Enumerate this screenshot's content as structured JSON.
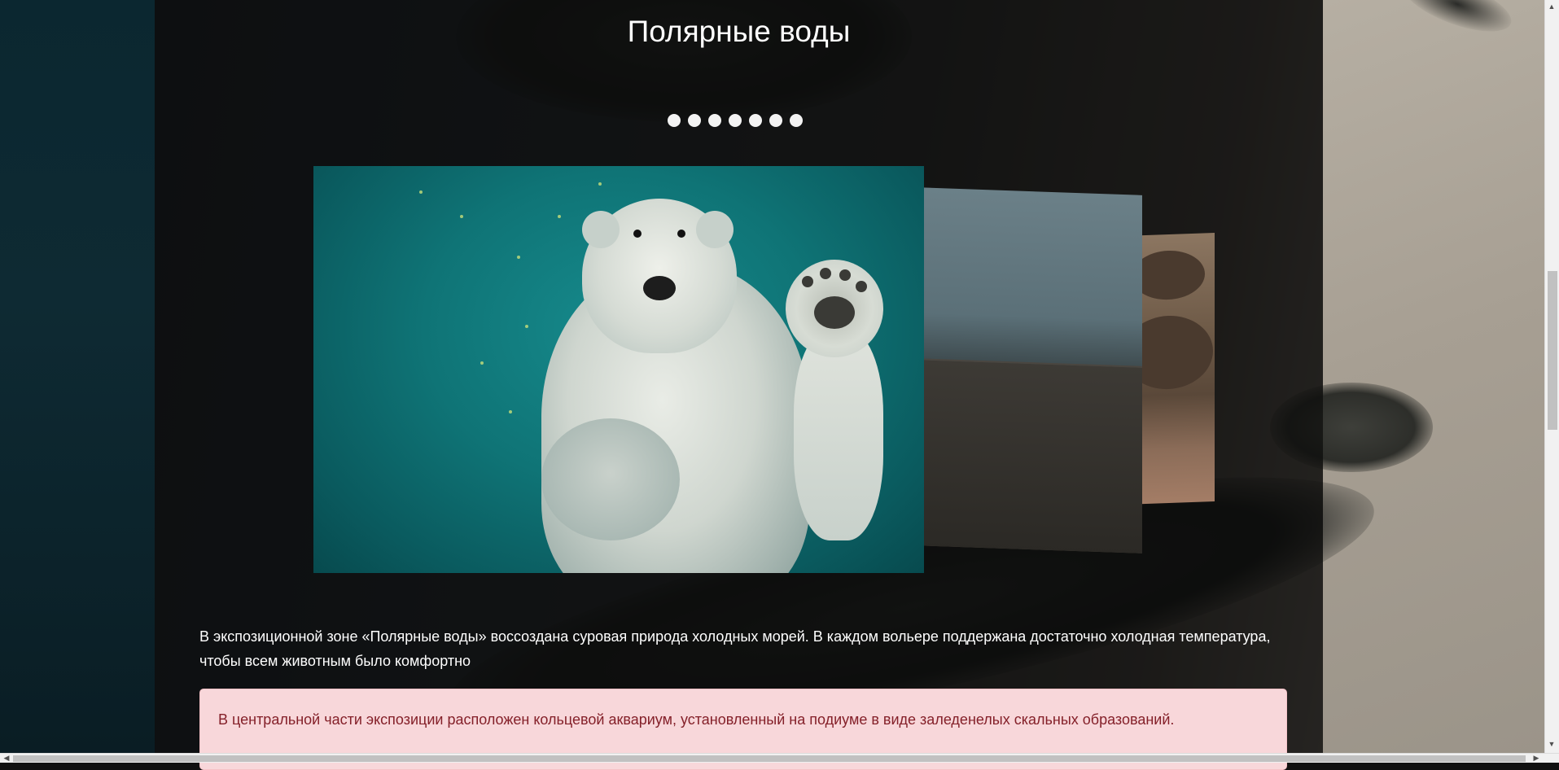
{
  "section": {
    "title": "Полярные воды"
  },
  "carousel": {
    "dot_count": 7,
    "active_index": 0,
    "slides": [
      {
        "subject": "polar-bear-underwater"
      },
      {
        "subject": "rock-enclosure"
      },
      {
        "subject": "seals-on-rocks"
      }
    ]
  },
  "content": {
    "lead": "В экспозиционной зоне «Полярные воды» воссоздана суровая природа холодных морей. В каждом вольере поддержана достаточно холодная температура, чтобы всем животным было комфортно",
    "alert": "В центральной части экспозиции расположен кольцевой аквариум, установленный на подиуме в виде заледенелых скальных образований."
  },
  "colors": {
    "alert_bg": "#f8d7da",
    "alert_text": "#842029",
    "overlay": "rgba(0,0,0,0.55)"
  },
  "scrollbars": {
    "up_arrow": "▲",
    "down_arrow": "▼",
    "left_arrow": "◀",
    "right_arrow": "▶"
  }
}
